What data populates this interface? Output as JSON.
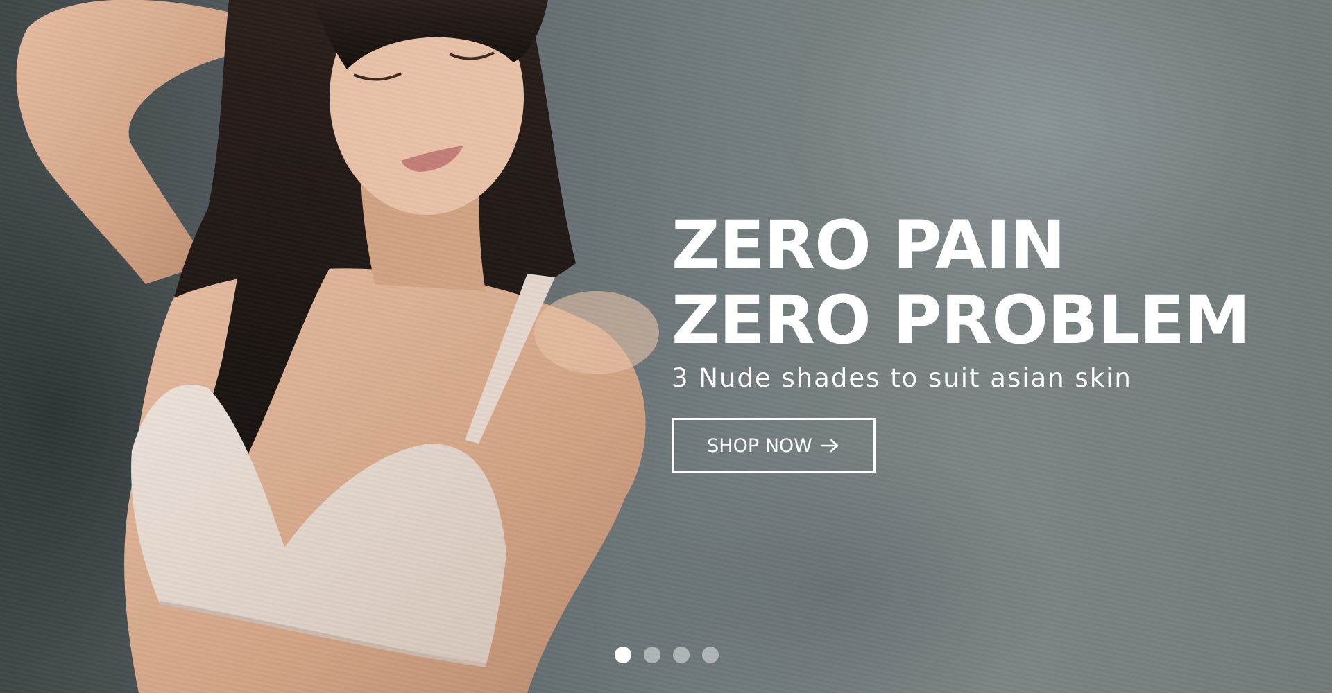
{
  "hero": {
    "headline_line_1": "ZERO PAIN",
    "headline_line_2": "ZERO PROBLEM",
    "subheadline": "3 Nude shades to suit asian skin",
    "cta_label": "SHOP NOW",
    "cta_icon": "arrow-right-icon"
  },
  "carousel": {
    "slide_count": 4,
    "active_index": 0
  },
  "colors": {
    "text": "#ffffff",
    "background": "#737c7e",
    "skin": "#d9ad92",
    "garment": "#e6d9d0",
    "hair": "#1e1714"
  }
}
